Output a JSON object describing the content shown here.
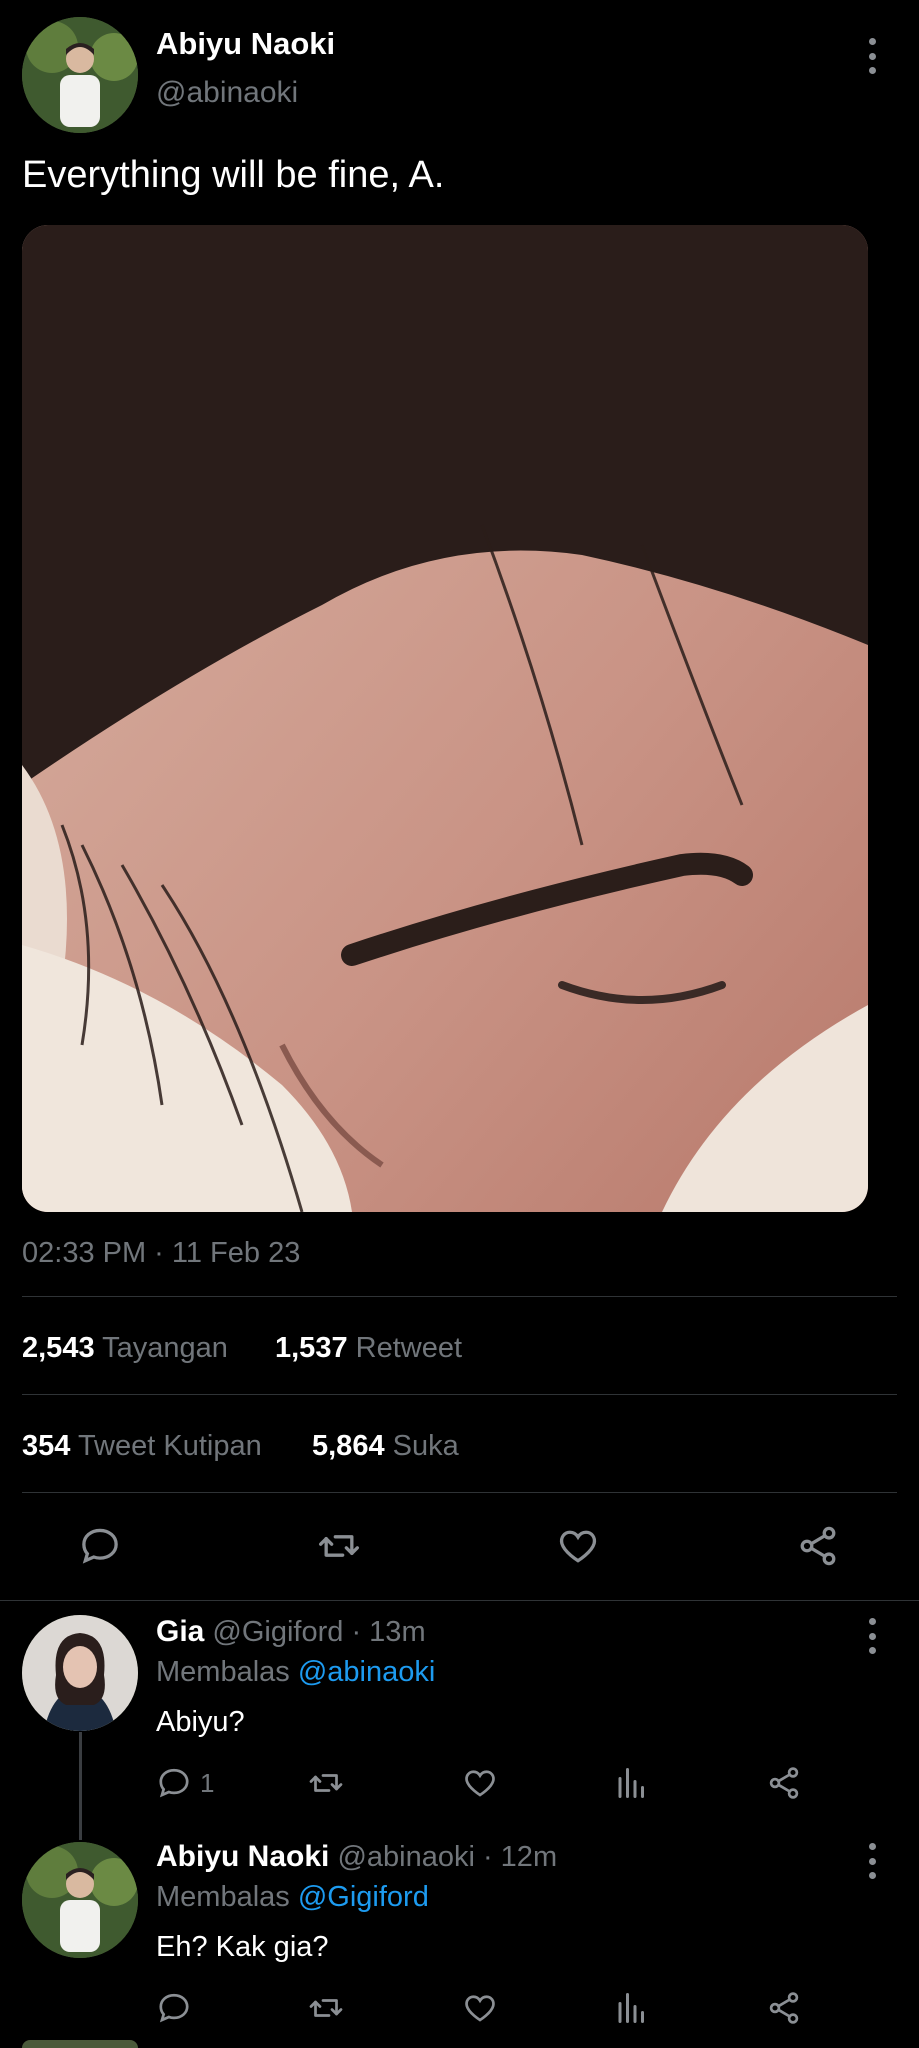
{
  "main_tweet": {
    "author_name": "Abiyu Naoki",
    "author_handle": "@abinaoki",
    "text": "Everything will be fine, A.",
    "timestamp": "02:33 PM · 11 Feb 23",
    "stats": {
      "views_count": "2,543",
      "views_label": "Tayangan",
      "retweets_count": "1,537",
      "retweets_label": "Retweet",
      "quotes_count": "354",
      "quotes_label": "Tweet Kutipan",
      "likes_count": "5,864",
      "likes_label": "Suka"
    },
    "actions": [
      "reply-icon",
      "retweet-icon",
      "heart-icon",
      "share-icon"
    ]
  },
  "replies": [
    {
      "author_name": "Gia",
      "author_handle": "@Gigiford",
      "time": "· 13m",
      "replying_label": "Membalas",
      "replying_to": "@abinaoki",
      "text": "Abiyu?",
      "reply_count": "1"
    },
    {
      "author_name": "Abiyu Naoki",
      "author_handle": "@abinaoki",
      "time": "· 12m",
      "replying_label": "Membalas",
      "replying_to": "@Gigiford",
      "text": "Eh? Kak gia?",
      "reply_count": ""
    }
  ],
  "colors": {
    "background": "#000000",
    "text": "#e7e9ea",
    "muted": "#71767b",
    "link": "#1d9bf0",
    "divider": "#2f3336"
  }
}
